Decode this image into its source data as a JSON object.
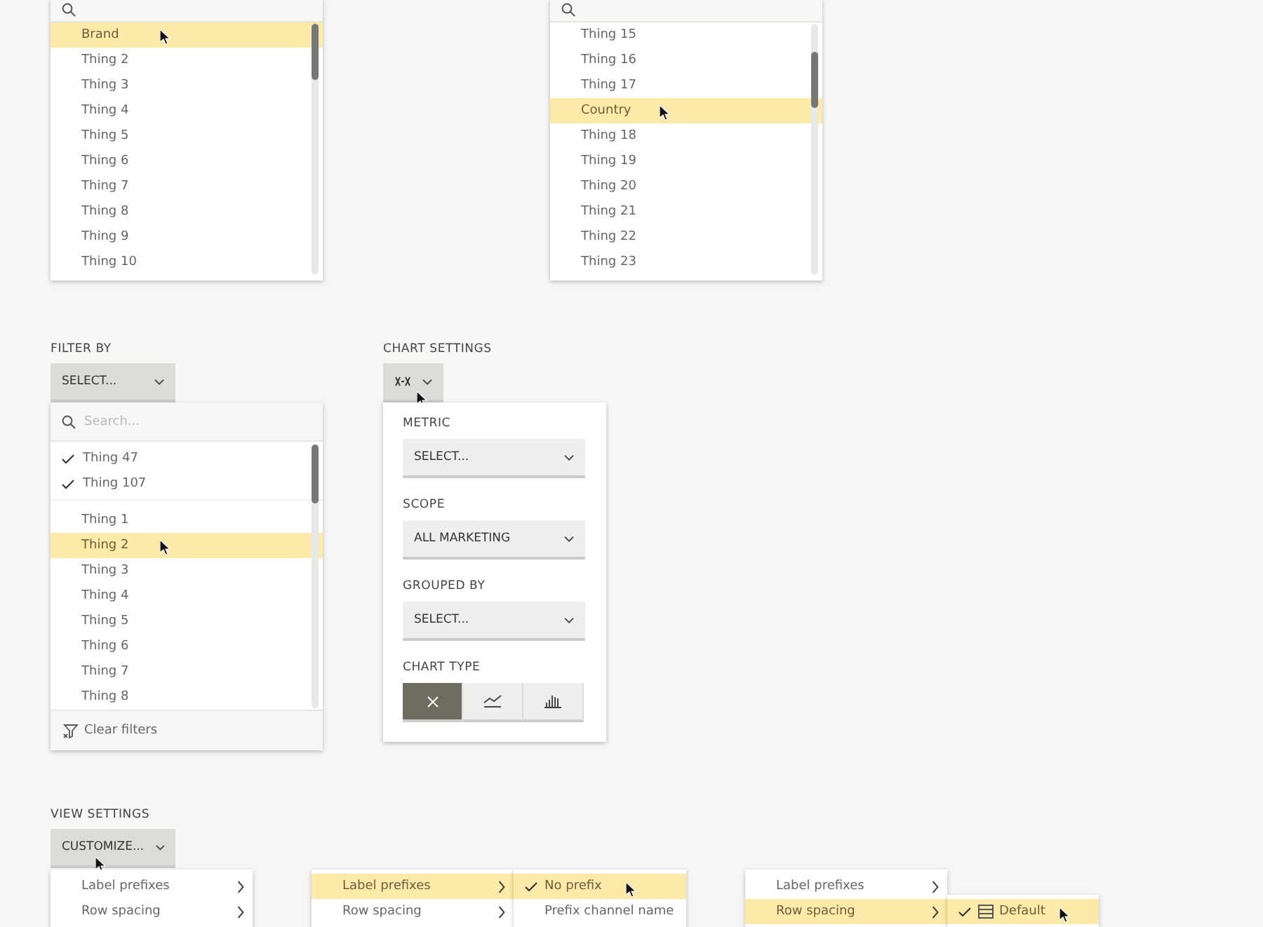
{
  "list_panels": [
    {
      "items": [
        {
          "label": "Brand",
          "selected": true
        },
        {
          "label": "Thing 2",
          "selected": false
        },
        {
          "label": "Thing 3",
          "selected": false
        },
        {
          "label": "Thing 4",
          "selected": false
        },
        {
          "label": "Thing 5",
          "selected": false
        },
        {
          "label": "Thing 6",
          "selected": false
        },
        {
          "label": "Thing 7",
          "selected": false
        },
        {
          "label": "Thing 8",
          "selected": false
        },
        {
          "label": "Thing 9",
          "selected": false
        },
        {
          "label": "Thing 10",
          "selected": false
        }
      ]
    },
    {
      "items": [
        {
          "label": "Thing 15",
          "selected": false
        },
        {
          "label": "Thing 16",
          "selected": false
        },
        {
          "label": "Thing 17",
          "selected": false
        },
        {
          "label": "Country",
          "selected": true
        },
        {
          "label": "Thing 18",
          "selected": false
        },
        {
          "label": "Thing 19",
          "selected": false
        },
        {
          "label": "Thing 20",
          "selected": false
        },
        {
          "label": "Thing 21",
          "selected": false
        },
        {
          "label": "Thing 22",
          "selected": false
        },
        {
          "label": "Thing 23",
          "selected": false
        }
      ]
    }
  ],
  "filter": {
    "label": "FILTER BY",
    "button": "SELECT...",
    "search": {
      "placeholder": "Search..."
    },
    "checked_items": [
      {
        "label": "Thing 47",
        "checked": true
      },
      {
        "label": "Thing 107",
        "checked": true
      }
    ],
    "items": [
      {
        "label": "Thing 1",
        "selected": false
      },
      {
        "label": "Thing 2",
        "selected": true
      },
      {
        "label": "Thing 3",
        "selected": false
      },
      {
        "label": "Thing 4",
        "selected": false
      },
      {
        "label": "Thing 5",
        "selected": false
      },
      {
        "label": "Thing 6",
        "selected": false
      },
      {
        "label": "Thing 7",
        "selected": false
      },
      {
        "label": "Thing 8",
        "selected": false
      }
    ],
    "footer": "Clear filters"
  },
  "chart_settings": {
    "label": "CHART SETTINGS",
    "fields": [
      {
        "label": "METRIC",
        "value": "SELECT..."
      },
      {
        "label": "SCOPE",
        "value": "ALL MARKETING"
      },
      {
        "label": "GROUPED BY",
        "value": "SELECT..."
      }
    ],
    "chart_type": {
      "label": "CHART TYPE",
      "options": [
        {
          "kind": "scatter",
          "selected": true
        },
        {
          "kind": "line",
          "selected": false
        },
        {
          "kind": "bar",
          "selected": false
        }
      ]
    }
  },
  "view_settings": {
    "label": "VIEW SETTINGS",
    "button": "CUSTOMIZE...",
    "menus": [
      {
        "items": [
          {
            "label": "Label prefixes",
            "selected": false
          },
          {
            "label": "Row spacing",
            "selected": false
          }
        ]
      },
      {
        "items": [
          {
            "label": "Label prefixes",
            "selected": true
          },
          {
            "label": "Row spacing",
            "selected": false
          }
        ],
        "submenu": {
          "items": [
            {
              "label": "No prefix",
              "checked": true,
              "selected": true,
              "kind": "plain"
            },
            {
              "label": "Prefix channel name",
              "checked": false,
              "selected": false,
              "kind": "plain"
            }
          ]
        }
      },
      {
        "items": [
          {
            "label": "Label prefixes",
            "selected": false
          },
          {
            "label": "Row spacing",
            "selected": true
          }
        ],
        "submenu": {
          "items": [
            {
              "label": "Default",
              "checked": true,
              "selected": true,
              "kind": "rows"
            }
          ]
        }
      }
    ]
  }
}
